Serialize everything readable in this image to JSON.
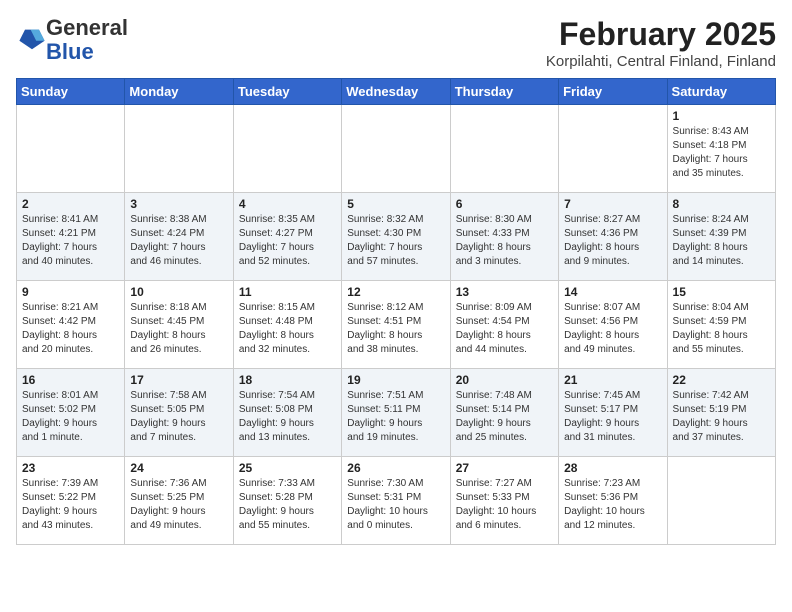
{
  "header": {
    "logo_general": "General",
    "logo_blue": "Blue",
    "month": "February 2025",
    "location": "Korpilahti, Central Finland, Finland"
  },
  "days_of_week": [
    "Sunday",
    "Monday",
    "Tuesday",
    "Wednesday",
    "Thursday",
    "Friday",
    "Saturday"
  ],
  "weeks": [
    [
      {
        "day": "",
        "info": ""
      },
      {
        "day": "",
        "info": ""
      },
      {
        "day": "",
        "info": ""
      },
      {
        "day": "",
        "info": ""
      },
      {
        "day": "",
        "info": ""
      },
      {
        "day": "",
        "info": ""
      },
      {
        "day": "1",
        "info": "Sunrise: 8:43 AM\nSunset: 4:18 PM\nDaylight: 7 hours\nand 35 minutes."
      }
    ],
    [
      {
        "day": "2",
        "info": "Sunrise: 8:41 AM\nSunset: 4:21 PM\nDaylight: 7 hours\nand 40 minutes."
      },
      {
        "day": "3",
        "info": "Sunrise: 8:38 AM\nSunset: 4:24 PM\nDaylight: 7 hours\nand 46 minutes."
      },
      {
        "day": "4",
        "info": "Sunrise: 8:35 AM\nSunset: 4:27 PM\nDaylight: 7 hours\nand 52 minutes."
      },
      {
        "day": "5",
        "info": "Sunrise: 8:32 AM\nSunset: 4:30 PM\nDaylight: 7 hours\nand 57 minutes."
      },
      {
        "day": "6",
        "info": "Sunrise: 8:30 AM\nSunset: 4:33 PM\nDaylight: 8 hours\nand 3 minutes."
      },
      {
        "day": "7",
        "info": "Sunrise: 8:27 AM\nSunset: 4:36 PM\nDaylight: 8 hours\nand 9 minutes."
      },
      {
        "day": "8",
        "info": "Sunrise: 8:24 AM\nSunset: 4:39 PM\nDaylight: 8 hours\nand 14 minutes."
      }
    ],
    [
      {
        "day": "9",
        "info": "Sunrise: 8:21 AM\nSunset: 4:42 PM\nDaylight: 8 hours\nand 20 minutes."
      },
      {
        "day": "10",
        "info": "Sunrise: 8:18 AM\nSunset: 4:45 PM\nDaylight: 8 hours\nand 26 minutes."
      },
      {
        "day": "11",
        "info": "Sunrise: 8:15 AM\nSunset: 4:48 PM\nDaylight: 8 hours\nand 32 minutes."
      },
      {
        "day": "12",
        "info": "Sunrise: 8:12 AM\nSunset: 4:51 PM\nDaylight: 8 hours\nand 38 minutes."
      },
      {
        "day": "13",
        "info": "Sunrise: 8:09 AM\nSunset: 4:54 PM\nDaylight: 8 hours\nand 44 minutes."
      },
      {
        "day": "14",
        "info": "Sunrise: 8:07 AM\nSunset: 4:56 PM\nDaylight: 8 hours\nand 49 minutes."
      },
      {
        "day": "15",
        "info": "Sunrise: 8:04 AM\nSunset: 4:59 PM\nDaylight: 8 hours\nand 55 minutes."
      }
    ],
    [
      {
        "day": "16",
        "info": "Sunrise: 8:01 AM\nSunset: 5:02 PM\nDaylight: 9 hours\nand 1 minute."
      },
      {
        "day": "17",
        "info": "Sunrise: 7:58 AM\nSunset: 5:05 PM\nDaylight: 9 hours\nand 7 minutes."
      },
      {
        "day": "18",
        "info": "Sunrise: 7:54 AM\nSunset: 5:08 PM\nDaylight: 9 hours\nand 13 minutes."
      },
      {
        "day": "19",
        "info": "Sunrise: 7:51 AM\nSunset: 5:11 PM\nDaylight: 9 hours\nand 19 minutes."
      },
      {
        "day": "20",
        "info": "Sunrise: 7:48 AM\nSunset: 5:14 PM\nDaylight: 9 hours\nand 25 minutes."
      },
      {
        "day": "21",
        "info": "Sunrise: 7:45 AM\nSunset: 5:17 PM\nDaylight: 9 hours\nand 31 minutes."
      },
      {
        "day": "22",
        "info": "Sunrise: 7:42 AM\nSunset: 5:19 PM\nDaylight: 9 hours\nand 37 minutes."
      }
    ],
    [
      {
        "day": "23",
        "info": "Sunrise: 7:39 AM\nSunset: 5:22 PM\nDaylight: 9 hours\nand 43 minutes."
      },
      {
        "day": "24",
        "info": "Sunrise: 7:36 AM\nSunset: 5:25 PM\nDaylight: 9 hours\nand 49 minutes."
      },
      {
        "day": "25",
        "info": "Sunrise: 7:33 AM\nSunset: 5:28 PM\nDaylight: 9 hours\nand 55 minutes."
      },
      {
        "day": "26",
        "info": "Sunrise: 7:30 AM\nSunset: 5:31 PM\nDaylight: 10 hours\nand 0 minutes."
      },
      {
        "day": "27",
        "info": "Sunrise: 7:27 AM\nSunset: 5:33 PM\nDaylight: 10 hours\nand 6 minutes."
      },
      {
        "day": "28",
        "info": "Sunrise: 7:23 AM\nSunset: 5:36 PM\nDaylight: 10 hours\nand 12 minutes."
      },
      {
        "day": "",
        "info": ""
      }
    ]
  ]
}
